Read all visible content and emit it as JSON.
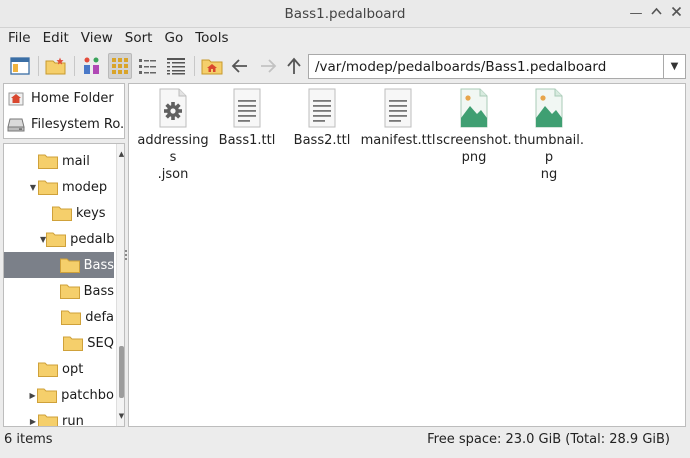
{
  "window": {
    "title": "Bass1.pedalboard"
  },
  "menu": [
    "File",
    "Edit",
    "View",
    "Sort",
    "Go",
    "Tools"
  ],
  "toolbar": {
    "path": "/var/modep/pedalboards/Bass1.pedalboard"
  },
  "places": [
    {
      "label": "Home Folder",
      "icon": "home-icon"
    },
    {
      "label": "Filesystem Ro...",
      "icon": "drive-icon"
    }
  ],
  "tree": [
    {
      "label": "mail",
      "expander": ""
    },
    {
      "label": "modep",
      "expander": "▼"
    },
    {
      "label": "keys",
      "expander": ""
    },
    {
      "label": "pedalb",
      "expander": "▼"
    },
    {
      "label": "Bass",
      "expander": ""
    },
    {
      "label": "Bass",
      "expander": ""
    },
    {
      "label": "defa",
      "expander": ""
    },
    {
      "label": "SEQ",
      "expander": ""
    },
    {
      "label": "opt",
      "expander": ""
    },
    {
      "label": "patchbo",
      "expander": "▶"
    },
    {
      "label": "run",
      "expander": "▶"
    }
  ],
  "files": [
    {
      "name": "addressings.json",
      "line1": "addressings",
      "line2": ".json",
      "type": "config"
    },
    {
      "name": "Bass1.ttl",
      "line1": "Bass1.ttl",
      "line2": "",
      "type": "text"
    },
    {
      "name": "Bass2.ttl",
      "line1": "Bass2.ttl",
      "line2": "",
      "type": "text"
    },
    {
      "name": "manifest.ttl",
      "line1": "manifest.ttl",
      "line2": "",
      "type": "text"
    },
    {
      "name": "screenshot.png",
      "line1": "screenshot.",
      "line2": "png",
      "type": "image"
    },
    {
      "name": "thumbnail.png",
      "line1": "thumbnail.p",
      "line2": "ng",
      "type": "image"
    }
  ],
  "status": {
    "items": "6 items",
    "free_space": "Free space: 23.0 GiB (Total: 28.9 GiB)"
  },
  "colors": {
    "selection": "#7b8089",
    "folder": "#f5cf6b",
    "image_icon": "#3f9f72"
  }
}
